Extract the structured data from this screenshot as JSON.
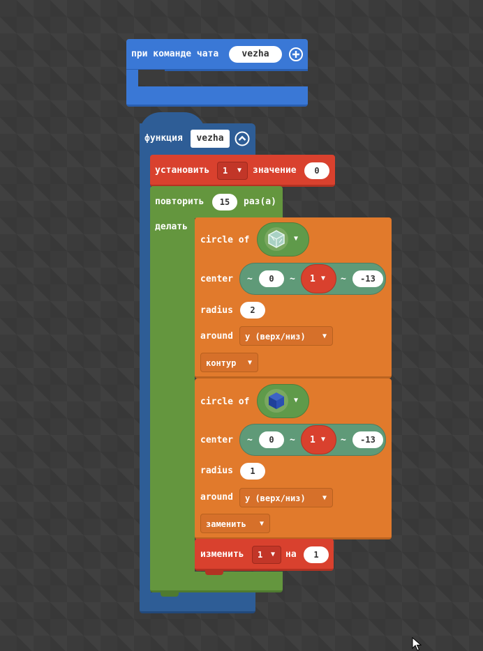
{
  "event_block": {
    "label": "при команде чата",
    "command_value": "vezha"
  },
  "function_block": {
    "label": "функция",
    "name": "vezha"
  },
  "set_block": {
    "label": "установить",
    "variable": "1",
    "value_label": "значение",
    "value": "0"
  },
  "repeat_block": {
    "label": "повторить",
    "count": "15",
    "suffix": "раз(а)",
    "do_label": "делать"
  },
  "circle_blocks": [
    {
      "label": "circle of",
      "center_label": "center",
      "x": "0",
      "y": "1",
      "z": "-13",
      "radius_label": "radius",
      "radius": "2",
      "around_label": "around",
      "around_value": "y (верх/низ)",
      "mode_value": "контур",
      "block_icon": "glass-block-icon"
    },
    {
      "label": "circle of",
      "center_label": "center",
      "x": "0",
      "y": "1",
      "z": "-13",
      "radius_label": "radius",
      "radius": "1",
      "around_label": "around",
      "around_value": "y (верх/низ)",
      "mode_value": "заменить",
      "block_icon": "lapis-block-icon"
    }
  ],
  "change_block": {
    "label": "изменить",
    "variable": "1",
    "by_label": "на",
    "value": "1"
  },
  "tilde": "~",
  "colors": {
    "events": "#3a78d6",
    "functions": "#2e5d96",
    "variables": "#d9412e",
    "loops": "#64963e",
    "shapes": "#e17a2c",
    "positions": "#5f9a78"
  }
}
